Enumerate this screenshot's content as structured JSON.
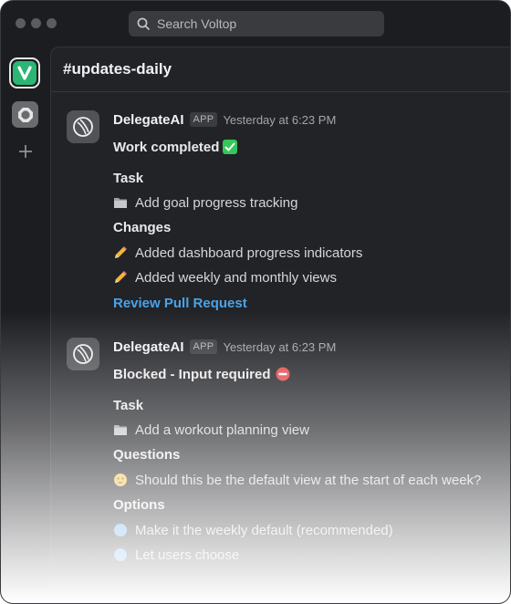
{
  "search": {
    "placeholder": "Search Voltop"
  },
  "workspace": {
    "letter": "V"
  },
  "channel": {
    "name": "#updates-daily"
  },
  "messages": [
    {
      "sender": "DelegateAI",
      "badge": "APP",
      "time": "Yesterday at 6:23 PM",
      "status": "Work completed",
      "status_icon": "check-mark-icon",
      "task_heading": "Task",
      "task": "Add goal progress tracking",
      "changes_heading": "Changes",
      "changes": [
        "Added dashboard progress indicators",
        "Added weekly and monthly views"
      ],
      "link": "Review Pull Request"
    },
    {
      "sender": "DelegateAI",
      "badge": "APP",
      "time": "Yesterday at 6:23 PM",
      "status": "Blocked - Input required",
      "status_icon": "no-entry-icon",
      "task_heading": "Task",
      "task": "Add a workout planning view",
      "questions_heading": "Questions",
      "question": "Should this be the default view at the start of each week?",
      "options_heading": "Options",
      "options": [
        "Make it the weekly default (recommended)",
        "Let users choose"
      ]
    }
  ],
  "colors": {
    "window_bg": "#1c1d21",
    "panel_bg": "#222327",
    "accent": "#2bb673",
    "link": "#4aa3e8",
    "check": "#35c759",
    "no_entry": "#e34a4a"
  }
}
